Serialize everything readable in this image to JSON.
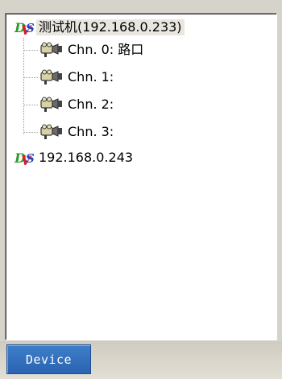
{
  "tree": {
    "devices": [
      {
        "label": "测试机(192.168.0.233)",
        "icon": "dvs-device-icon",
        "selected": true,
        "channels": [
          {
            "label": "Chn. 0: 路口",
            "icon": "camera-icon"
          },
          {
            "label": "Chn. 1:",
            "icon": "camera-icon"
          },
          {
            "label": "Chn. 2:",
            "icon": "camera-icon"
          },
          {
            "label": "Chn. 3:",
            "icon": "camera-icon"
          }
        ]
      },
      {
        "label": "192.168.0.243",
        "icon": "dvs-device-icon",
        "selected": false,
        "channels": []
      }
    ]
  },
  "tabs": {
    "device_label": "Device"
  },
  "colors": {
    "tab_active": "#2f6fbe",
    "panel_bg": "#ffffff",
    "frame_bg": "#d6d3ca"
  }
}
